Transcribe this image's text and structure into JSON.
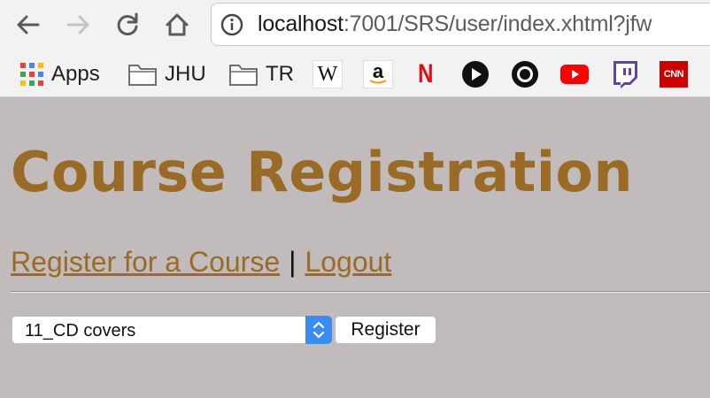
{
  "browser": {
    "url_host": "localhost",
    "url_rest": ":7001/SRS/user/index.xhtml?jfw",
    "icons": {
      "back": "arrow-left-icon",
      "forward": "arrow-right-icon",
      "reload": "reload-icon",
      "home": "home-icon",
      "site_info": "info-icon"
    }
  },
  "bookmarks": [
    {
      "label": "Apps",
      "icon": "apps-grid-icon"
    },
    {
      "label": "JHU",
      "icon": "folder-icon"
    },
    {
      "label": "TR",
      "icon": "folder-icon"
    },
    {
      "label": "W",
      "icon": "wikipedia-icon"
    },
    {
      "label": "a",
      "icon": "amazon-icon"
    },
    {
      "label": "N",
      "icon": "netflix-icon"
    },
    {
      "label": "",
      "icon": "play-icon"
    },
    {
      "label": "",
      "icon": "circle-icon"
    },
    {
      "label": "",
      "icon": "youtube-icon"
    },
    {
      "label": "",
      "icon": "twitch-icon"
    },
    {
      "label": "CNN",
      "icon": "cnn-icon"
    }
  ],
  "page": {
    "title": "Course Registration",
    "links": {
      "register": "Register for a Course",
      "separator": "|",
      "logout": "Logout"
    },
    "course_select": {
      "selected": "11_CD covers"
    },
    "register_button": "Register"
  },
  "colors": {
    "accent": "#996b26",
    "background": "#c1bcbb",
    "select_arrow": "#3b8cf2"
  }
}
